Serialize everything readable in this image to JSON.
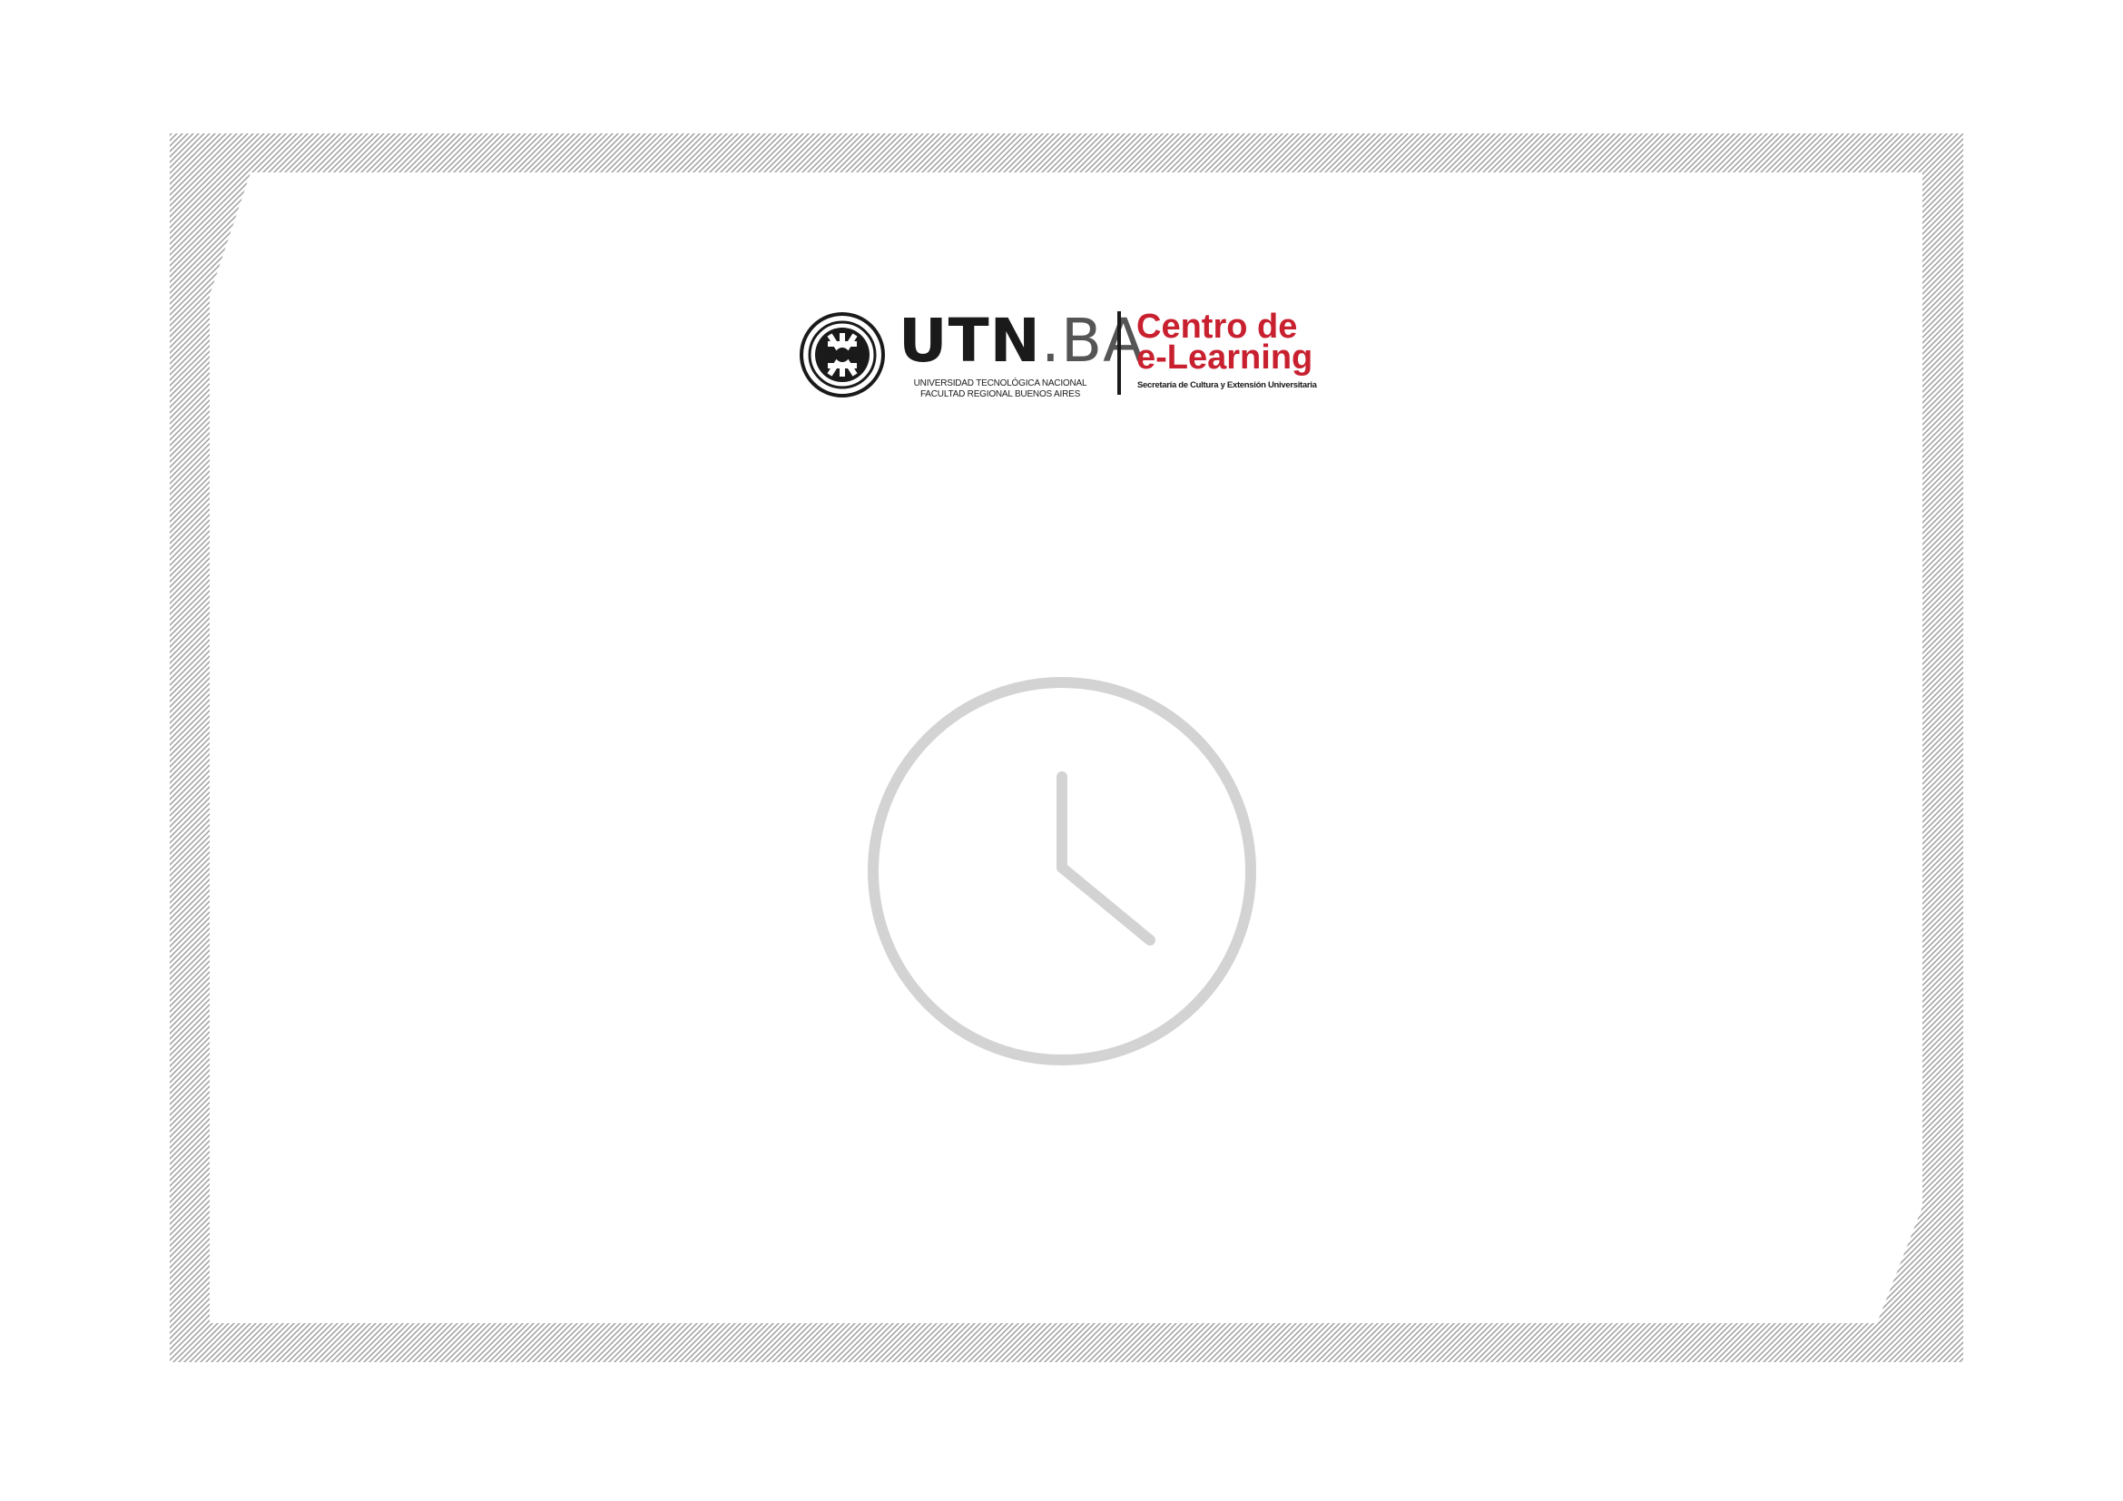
{
  "logo": {
    "utn_main": "UTN",
    "utn_suffix": ".BA",
    "utn_line1": "UNIVERSIDAD TECNOLÓGICA NACIONAL",
    "utn_line2": "FACULTAD REGIONAL BUENOS AIRES",
    "cel_line1": "Centro de",
    "cel_line2": "e-Learning",
    "cel_subtitle": "Secretaría de Cultura y Extensión Universitaria"
  },
  "colors": {
    "brand_red": "#c8202f",
    "frame_hatch": "#a6a6a6",
    "clock_gray": "#d3d3d3",
    "text_dark": "#1a1a1a"
  },
  "icons": {
    "emblem": "utn-emblem-icon",
    "clock": "clock-icon"
  }
}
